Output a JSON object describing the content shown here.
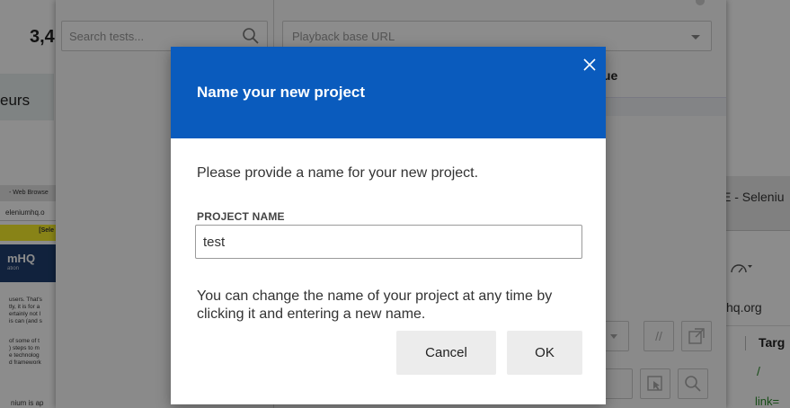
{
  "background_page": {
    "number_text": "3,4",
    "band_text": "eurs",
    "browser": {
      "title": "- Web Browse",
      "url": "eleniumhq.o",
      "yellow_text": "[Sele",
      "logo_text": "mHQ",
      "logo_sub": "ation",
      "para1": [
        "users. That's",
        "tly, it is for a",
        "ertainly not l",
        "is can (and s"
      ],
      "para2": [
        "of some of t",
        ") steps to m",
        "e technolog",
        "d framework"
      ],
      "bottom_text": "nium is ap"
    }
  },
  "ide": {
    "search_placeholder": "Search tests...",
    "playback_placeholder": "Playback base URL",
    "column_header": "lue",
    "toolbar_glyphs": [
      "//"
    ]
  },
  "right_window": {
    "title": "E - Seleniu",
    "url": "hq.org",
    "target_header": "Targ",
    "row1": "/",
    "row2": "link="
  },
  "dialog": {
    "title": "Name your new project",
    "description": "Please provide a name for your new project.",
    "field_label": "PROJECT NAME",
    "field_value": "test",
    "note": "You can change the name of your project at any time by clicking it and entering a new name.",
    "cancel_label": "Cancel",
    "ok_label": "OK",
    "close_icon": "close-icon"
  },
  "colors": {
    "header_blue": "#0a5bbd",
    "button_gray": "#ececec",
    "link_green": "#2a8a2a"
  }
}
